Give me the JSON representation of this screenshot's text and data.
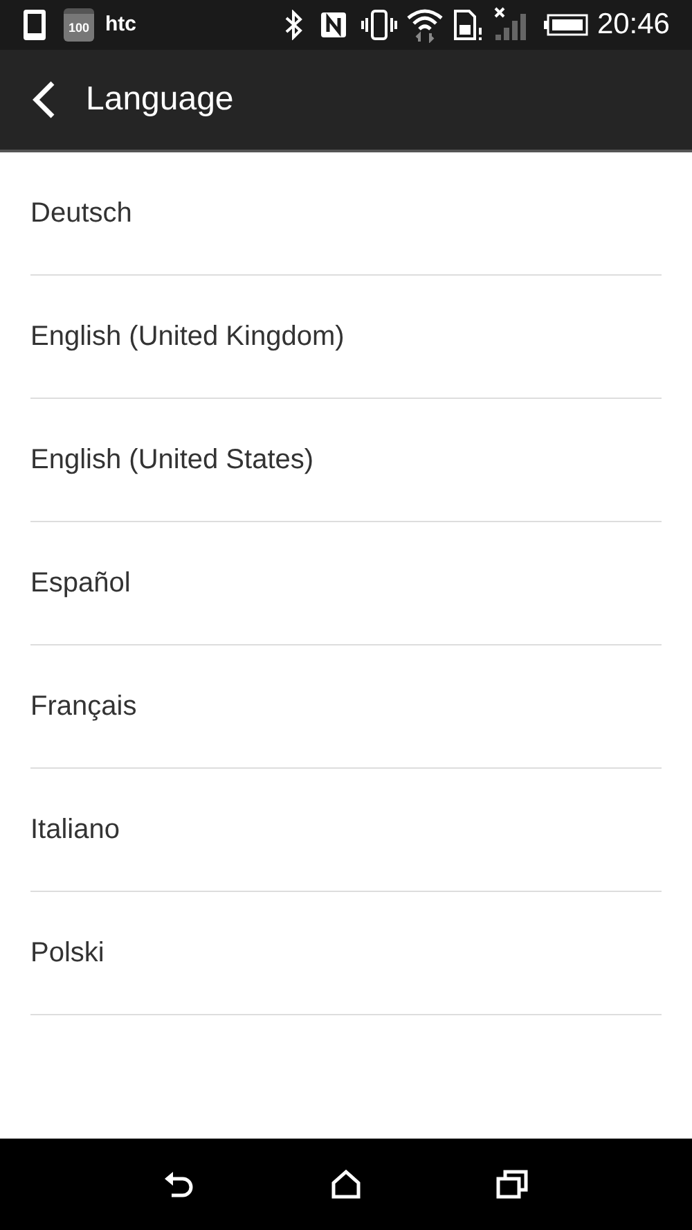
{
  "status_bar": {
    "calendar_number": "100",
    "carrier": "htc",
    "time": "20:46"
  },
  "app_bar": {
    "title": "Language"
  },
  "languages": [
    {
      "label": "Deutsch"
    },
    {
      "label": "English (United Kingdom)"
    },
    {
      "label": "English (United States)"
    },
    {
      "label": "Español"
    },
    {
      "label": "Français"
    },
    {
      "label": "Italiano"
    },
    {
      "label": "Polski"
    }
  ]
}
